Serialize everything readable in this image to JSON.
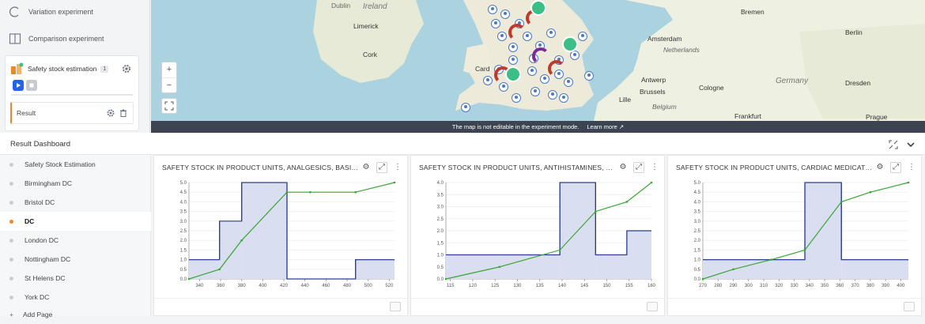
{
  "experiments": {
    "items": [
      {
        "label": "Variation experiment",
        "icon": "variation-icon"
      },
      {
        "label": "Comparison experiment",
        "icon": "comparison-icon"
      }
    ],
    "active": {
      "label": "Safety stock estimation",
      "count": "1",
      "result_label": "Result"
    }
  },
  "map": {
    "labels": [
      "Dublin",
      "Ireland",
      "Limerick",
      "Cork",
      "Card",
      "Bremen",
      "Amsterdam",
      "Netherlands",
      "Berlin",
      "Antwerp",
      "Brussels",
      "Belgium",
      "Lille",
      "Cologne",
      "Germany",
      "Dresden",
      "Frankfurt",
      "Prague"
    ],
    "zoom_in": "+",
    "zoom_out": "−",
    "banner": "The map is not editable in the experiment mode.",
    "learn_more": "Learn more ↗"
  },
  "dashboard": {
    "title": "Result Dashboard",
    "nav": [
      "Safety Stock Estimation",
      "Birmingham DC",
      "Bristol DC",
      "DC",
      "London DC",
      "Nottingham DC",
      "St Helens DC",
      "York DC",
      "Add Page"
    ],
    "active_index": 3
  },
  "colors": {
    "hist_fill": "#d9def0",
    "hist_stroke": "#2c3e8f",
    "line": "#3aa636",
    "accent": "#e58a2e"
  },
  "chart_data": [
    {
      "type": "bar",
      "title": "SAFETY STOCK IN PRODUCT UNITS, ANALGESICS, BASIC PER...",
      "xlim": [
        330,
        525
      ],
      "ylim": [
        0,
        5
      ],
      "x_ticks": [
        340,
        360,
        380,
        400,
        420,
        440,
        460,
        480,
        500,
        520
      ],
      "y_ticks": [
        0.0,
        0.5,
        1.0,
        1.5,
        2.0,
        2.5,
        3.0,
        3.5,
        4.0,
        4.5,
        5.0
      ],
      "bins": [
        {
          "x0": 330,
          "x1": 359,
          "y": 1
        },
        {
          "x0": 359,
          "x1": 380,
          "y": 3
        },
        {
          "x0": 380,
          "x1": 423,
          "y": 5
        },
        {
          "x0": 423,
          "x1": 488,
          "y": 0
        },
        {
          "x0": 488,
          "x1": 525,
          "y": 1
        }
      ],
      "line": [
        [
          330,
          0
        ],
        [
          359,
          0.5
        ],
        [
          380,
          2.0
        ],
        [
          423,
          4.5
        ],
        [
          445,
          4.5
        ],
        [
          488,
          4.5
        ],
        [
          525,
          5.0
        ]
      ]
    },
    {
      "type": "bar",
      "title": "SAFETY STOCK IN PRODUCT UNITS, ANTIHISTAMINES, BASI...",
      "xlim": [
        114,
        160
      ],
      "ylim": [
        0,
        4
      ],
      "x_ticks": [
        115,
        120,
        125,
        130,
        135,
        140,
        145,
        150,
        155,
        160
      ],
      "y_ticks": [
        0.0,
        0.5,
        1.0,
        1.5,
        2.0,
        2.5,
        3.0,
        3.5,
        4.0
      ],
      "bins": [
        {
          "x0": 114,
          "x1": 139.5,
          "y": 1
        },
        {
          "x0": 139.5,
          "x1": 147.5,
          "y": 4
        },
        {
          "x0": 147.5,
          "x1": 154.5,
          "y": 1
        },
        {
          "x0": 154.5,
          "x1": 160,
          "y": 2
        }
      ],
      "line": [
        [
          114,
          0
        ],
        [
          126,
          0.5
        ],
        [
          139.5,
          1.2
        ],
        [
          147.5,
          2.8
        ],
        [
          154.5,
          3.2
        ],
        [
          160,
          4.0
        ]
      ]
    },
    {
      "type": "bar",
      "title": "SAFETY STOCK IN PRODUCT UNITS, CARDIAC MEDICATIONS...",
      "xlim": [
        270,
        405
      ],
      "ylim": [
        0,
        5
      ],
      "x_ticks": [
        270,
        280,
        290,
        300,
        310,
        320,
        330,
        340,
        350,
        360,
        370,
        380,
        390,
        400
      ],
      "y_ticks": [
        0.0,
        0.5,
        1.0,
        1.5,
        2.0,
        2.5,
        3.0,
        3.5,
        4.0,
        4.5,
        5.0
      ],
      "bins": [
        {
          "x0": 270,
          "x1": 337,
          "y": 1
        },
        {
          "x0": 337,
          "x1": 361,
          "y": 5
        },
        {
          "x0": 361,
          "x1": 405,
          "y": 1
        }
      ],
      "line": [
        [
          270,
          0
        ],
        [
          290,
          0.5
        ],
        [
          315,
          1.0
        ],
        [
          337,
          1.5
        ],
        [
          361,
          4.0
        ],
        [
          380,
          4.5
        ],
        [
          405,
          5.0
        ]
      ]
    }
  ]
}
